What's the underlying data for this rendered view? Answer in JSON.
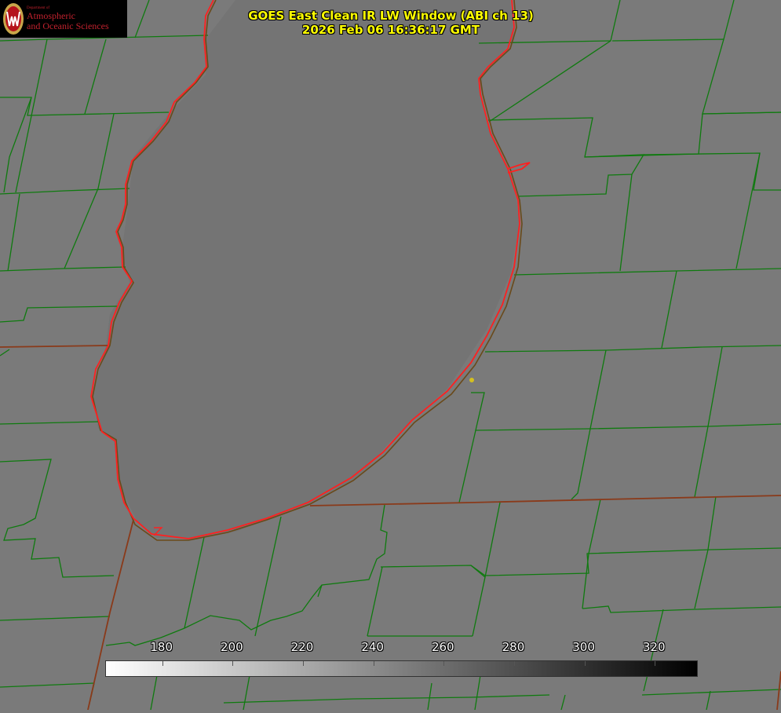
{
  "header": {
    "title_line1": "GOES East Clean IR LW Window (ABI ch 13)",
    "title_line2": "2026 Feb 06 16:36:17 GMT"
  },
  "logo": {
    "dept_line0": "Department of",
    "dept_line1": "Atmospheric",
    "dept_line2": "and Oceanic Sciences"
  },
  "colorbar": {
    "ticks": [
      180,
      200,
      220,
      240,
      260,
      280,
      300,
      320
    ],
    "range": [
      164,
      332
    ]
  },
  "colors": {
    "land": "#7a7a7a",
    "lake": "#747474",
    "county_lines": "#0f7a0f",
    "coastline": "#ff2020",
    "state_lines": "#8a3a1a",
    "title": "#ffff00",
    "city_dot": "#d4c020"
  }
}
